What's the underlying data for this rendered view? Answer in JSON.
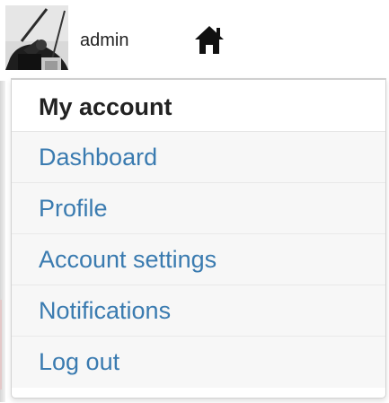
{
  "user": {
    "name": "admin",
    "avatar_icon": "user-avatar"
  },
  "nav": {
    "home_icon": "home-icon"
  },
  "menu": {
    "header": "My account",
    "items": [
      {
        "label": "Dashboard"
      },
      {
        "label": "Profile"
      },
      {
        "label": "Account settings"
      },
      {
        "label": "Notifications"
      },
      {
        "label": "Log out"
      }
    ]
  },
  "colors": {
    "link": "#3a7bb0",
    "header_text": "#222222",
    "item_background": "#f7f7f7"
  }
}
